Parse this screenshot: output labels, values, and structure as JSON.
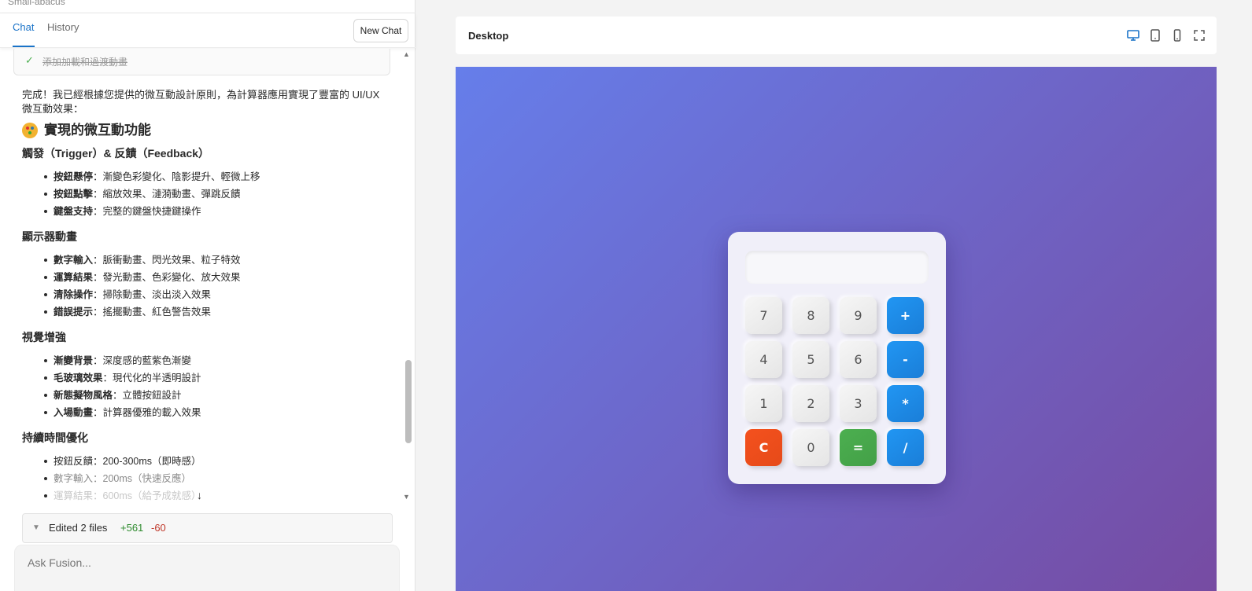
{
  "project": {
    "name": "Small-abacus"
  },
  "tabs": {
    "chat": "Chat",
    "history": "History"
  },
  "new_chat_label": "New Chat",
  "task": {
    "label": "添加加載和過渡動畫",
    "status": "done"
  },
  "message": {
    "intro": "完成！我已經根據您提供的微互動設計原則，為計算器應用實現了豐富的 UI/UX 微互動效果：",
    "heading": "實現的微互動功能",
    "heading_icon": "palette-icon",
    "sections": [
      {
        "title": "觸發（Trigger）& 反饋（Feedback）",
        "items": [
          {
            "term": "按鈕懸停",
            "desc": "：漸變色彩變化、陰影提升、輕微上移"
          },
          {
            "term": "按鈕點擊",
            "desc": "：縮放效果、漣漪動畫、彈跳反饋"
          },
          {
            "term": "鍵盤支持",
            "desc": "：完整的鍵盤快捷鍵操作"
          }
        ]
      },
      {
        "title": "顯示器動畫",
        "items": [
          {
            "term": "數字輸入",
            "desc": "：脈衝動畫、閃光效果、粒子特效"
          },
          {
            "term": "運算結果",
            "desc": "：發光動畫、色彩變化、放大效果"
          },
          {
            "term": "清除操作",
            "desc": "：掃除動畫、淡出淡入效果"
          },
          {
            "term": "錯誤提示",
            "desc": "：搖擺動畫、紅色警告效果"
          }
        ]
      },
      {
        "title": "視覺增強",
        "items": [
          {
            "term": "漸變背景",
            "desc": "：深度感的藍紫色漸變"
          },
          {
            "term": "毛玻璃效果",
            "desc": "：現代化的半透明設計"
          },
          {
            "term": "新態擬物風格",
            "desc": "：立體按鈕設計"
          },
          {
            "term": "入場動畫",
            "desc": "：計算器優雅的載入效果"
          }
        ]
      },
      {
        "title": "持續時間優化",
        "items": [
          {
            "term": "",
            "desc": "按鈕反饋：200-300ms（即時感）"
          },
          {
            "term": "",
            "desc": "數字輸入：200ms（快速反應）"
          },
          {
            "term": "",
            "desc": "運算結果：600ms（給予成就感）"
          }
        ]
      }
    ]
  },
  "edited": {
    "label": "Edited 2 files",
    "added": "+561",
    "removed": "-60"
  },
  "ask": {
    "placeholder": "Ask Fusion..."
  },
  "preview": {
    "title": "Desktop",
    "device_icons": [
      "desktop-icon",
      "tablet-icon",
      "mobile-icon",
      "fullscreen-icon"
    ],
    "background_gradient": [
      "#667eea",
      "#764ba2"
    ]
  },
  "calculator": {
    "display_value": "",
    "keys": [
      {
        "label": "7",
        "type": "num"
      },
      {
        "label": "8",
        "type": "num"
      },
      {
        "label": "9",
        "type": "num"
      },
      {
        "label": "+",
        "type": "op"
      },
      {
        "label": "4",
        "type": "num"
      },
      {
        "label": "5",
        "type": "num"
      },
      {
        "label": "6",
        "type": "num"
      },
      {
        "label": "-",
        "type": "op"
      },
      {
        "label": "1",
        "type": "num"
      },
      {
        "label": "2",
        "type": "num"
      },
      {
        "label": "3",
        "type": "num"
      },
      {
        "label": "*",
        "type": "op"
      },
      {
        "label": "C",
        "type": "clear"
      },
      {
        "label": "0",
        "type": "num"
      },
      {
        "label": "=",
        "type": "eq"
      },
      {
        "label": "/",
        "type": "op"
      }
    ]
  },
  "colors": {
    "accent": "#1a73c8",
    "op": "#1e88e5",
    "clear": "#f4511e",
    "equals": "#4caf50",
    "added": "#2e8b2e",
    "removed": "#c0392b"
  }
}
